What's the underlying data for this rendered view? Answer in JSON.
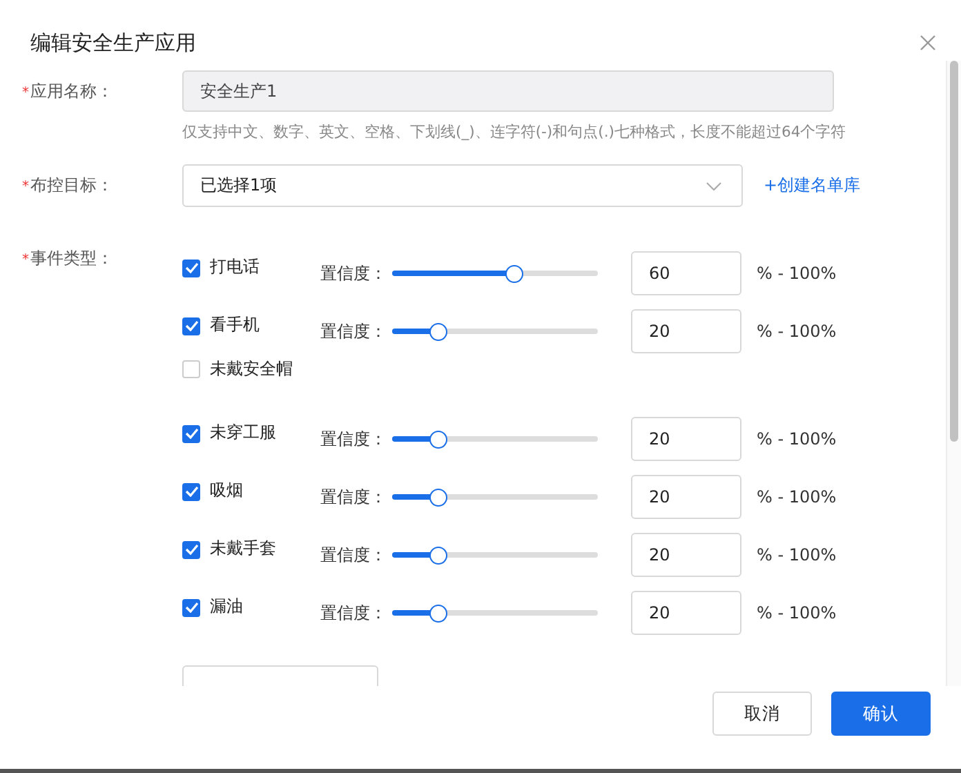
{
  "dialog": {
    "title": "编辑安全生产应用"
  },
  "form": {
    "app_name": {
      "label": "应用名称：",
      "required_mark": "*",
      "value": "安全生产1",
      "disabled": true,
      "hint": "仅支持中文、数字、英文、空格、下划线(_)、连字符(-)和句点(.)七种格式，长度不能超过64个字符"
    },
    "target": {
      "label": "布控目标：",
      "required_mark": "*",
      "value": "已选择1项",
      "link": "+创建名单库"
    },
    "events": {
      "label": "事件类型：",
      "required_mark": "*",
      "items": [
        {
          "name": "打电话",
          "checked": true,
          "slider_label": "置信度：",
          "level": 0.6,
          "value": "60",
          "range": "% - 100%"
        },
        {
          "name": "看手机",
          "checked": true,
          "slider_label": "置信度：",
          "level": 0.2,
          "value": "20",
          "range": "% - 100%"
        },
        {
          "name": "未戴安全帽",
          "checked": false
        },
        {
          "name": "未穿工服",
          "checked": true,
          "slider_label": "置信度：",
          "level": 0.2,
          "value": "20",
          "range": "% - 100%"
        },
        {
          "name": "吸烟",
          "checked": true,
          "slider_label": "置信度：",
          "level": 0.2,
          "value": "20",
          "range": "% - 100%"
        },
        {
          "name": "未戴手套",
          "checked": true,
          "slider_label": "置信度：",
          "level": 0.2,
          "value": "20",
          "range": "% - 100%"
        },
        {
          "name": "漏油",
          "checked": true,
          "slider_label": "置信度：",
          "level": 0.2,
          "value": "20",
          "range": "% - 100%"
        }
      ]
    }
  },
  "buttons": [
    {
      "label": "取消",
      "kind": "default"
    },
    {
      "label": "确认",
      "kind": "primary"
    }
  ]
}
